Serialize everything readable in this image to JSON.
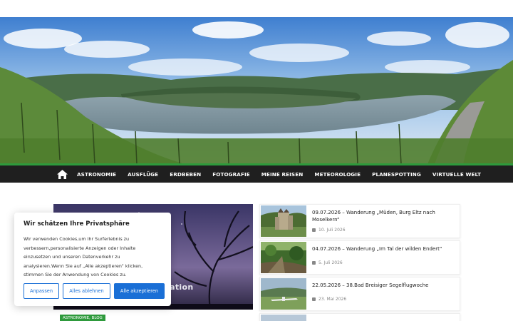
{
  "nav": {
    "items": [
      "ASTRONOMIE",
      "AUSFLÜGE",
      "ERDBEBEN",
      "FOTOGRAFIE",
      "MEINE REISEN",
      "METEOROLOGIE",
      "PLANESPOTTING",
      "VIRTUELLE WELT"
    ],
    "home_icon": "home-icon"
  },
  "featured": {
    "caption": "nation",
    "category": "ASTRONOMIE, BLOG"
  },
  "posts": [
    {
      "title": "09.07.2026 – Wanderung „Müden, Burg Eltz nach Moselkern“",
      "date": "10. Juli 2026"
    },
    {
      "title": "04.07.2026 – Wanderung „Im Tal der wilden Endert“",
      "date": "5. Juli 2026"
    },
    {
      "title": "22.05.2026 – 38.Bad Breisiger Segelflugwoche",
      "date": "23. Mai 2026"
    }
  ],
  "cookie": {
    "title": "Wir schätzen Ihre Privatsphäre",
    "text": "Wir verwenden Cookies,um Ihr Surferlebnis zu verbessern,personalisierte Anzeigen oder Inhalte einzusetzen und unseren Datenverkehr zu analysieren.Wenn Sie auf „Alle akzeptieren“ klicken, stimmen Sie der Anwendung von Cookies zu.",
    "customize": "Anpassen",
    "reject": "Alles ablehnen",
    "accept": "Alle akzeptieren"
  },
  "colors": {
    "accent": "#2e9a3c",
    "nav_bg": "#1f1f1f",
    "button_blue": "#1a6fd6"
  }
}
